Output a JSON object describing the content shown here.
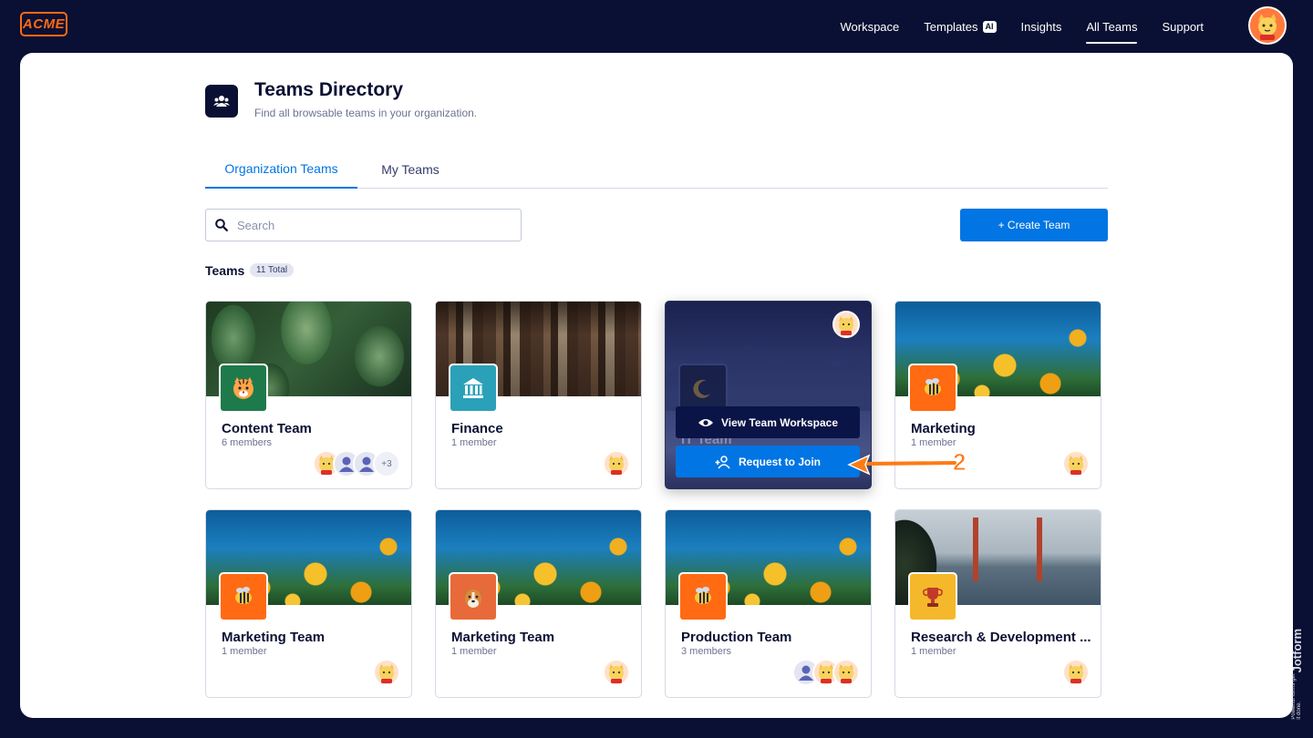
{
  "brand": {
    "logo_text": "ACME"
  },
  "nav": {
    "items": [
      {
        "label": "Workspace",
        "active": false
      },
      {
        "label": "Templates",
        "badge": "AI",
        "active": false
      },
      {
        "label": "Insights",
        "active": false
      },
      {
        "label": "All Teams",
        "active": true
      },
      {
        "label": "Support",
        "active": false
      }
    ]
  },
  "header": {
    "title": "Teams Directory",
    "subtitle": "Find all browsable teams in your organization."
  },
  "tabs": [
    {
      "label": "Organization Teams",
      "active": true
    },
    {
      "label": "My Teams",
      "active": false
    }
  ],
  "search": {
    "placeholder": "Search",
    "value": ""
  },
  "create_button": {
    "label": "+ Create Team"
  },
  "teams_section": {
    "label": "Teams",
    "count_badge": "11 Total"
  },
  "cards": [
    {
      "name": "Content Team",
      "members": "6 members",
      "cover": "leaves",
      "icon": "tiger-icon",
      "icon_bg": "#1e7a4a",
      "more_badge": "+3"
    },
    {
      "name": "Finance",
      "members": "1 member",
      "cover": "books",
      "icon": "bank-icon",
      "icon_bg": "#2aa1b8"
    },
    {
      "name": "IT Team",
      "members": "",
      "cover": "night",
      "icon": "moon-icon",
      "icon_bg": "#11193d",
      "hovered": true,
      "view_label": "View Team Workspace",
      "join_label": "Request to Join"
    },
    {
      "name": "Marketing",
      "members": "1 member",
      "cover": "flowers",
      "icon": "bee-icon",
      "icon_bg": "#ff6a13"
    },
    {
      "name": "Marketing Team",
      "members": "1 member",
      "cover": "flowers",
      "icon": "bee-icon",
      "icon_bg": "#ff6a13"
    },
    {
      "name": "Marketing Team",
      "members": "1 member",
      "cover": "flowers",
      "icon": "dog-icon",
      "icon_bg": "#e86a3a"
    },
    {
      "name": "Production Team",
      "members": "3 members",
      "cover": "flowers",
      "icon": "bee-icon",
      "icon_bg": "#ff6a13"
    },
    {
      "name": "Research & Development ...",
      "members": "1 member",
      "cover": "bridge",
      "icon": "trophy-icon",
      "icon_bg": "#f5b82a"
    }
  ],
  "annotation": {
    "number": "2"
  },
  "watermark": {
    "brand": "Jotform",
    "tagline": "Powerful forms get it done."
  },
  "colors": {
    "primary": "#0075e3",
    "navy": "#0a1033",
    "accent": "#ff6a13"
  }
}
